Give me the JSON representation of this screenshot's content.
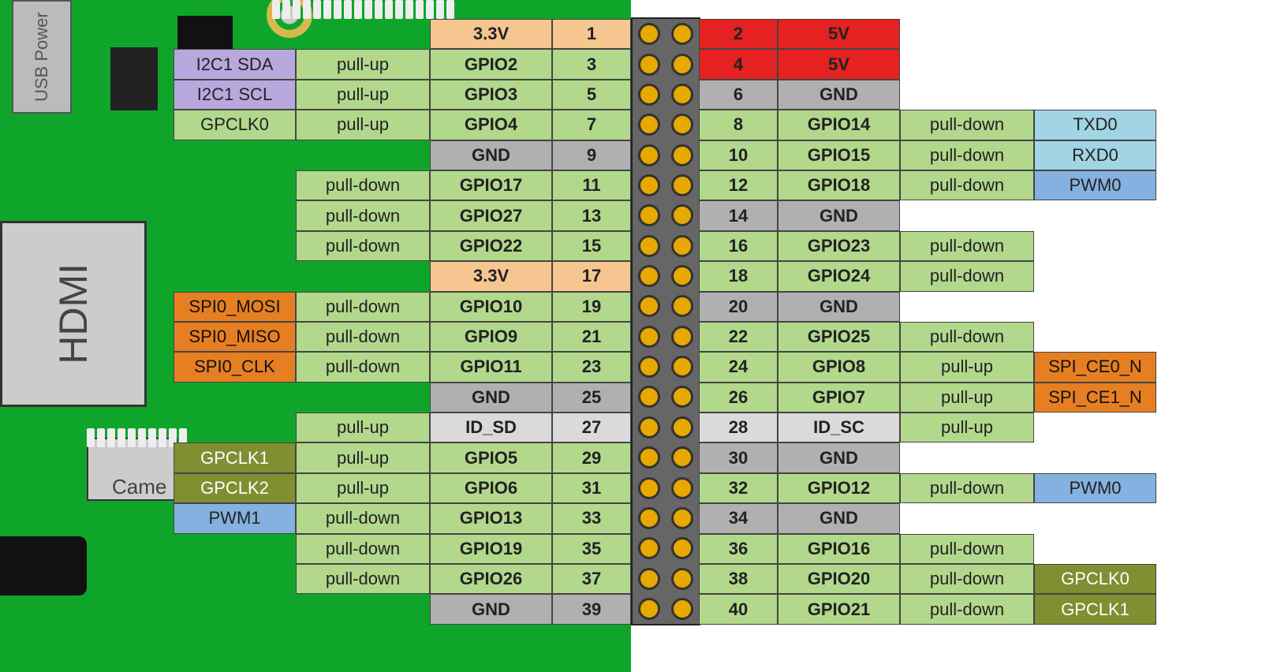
{
  "labels": {
    "usb": "USB\nPower",
    "hdmi": "HDMI",
    "camera": "Came"
  },
  "left": [
    {
      "num": "1",
      "name": "3.3V",
      "nc": "v33",
      "pull": "",
      "alt": "",
      "ac": ""
    },
    {
      "num": "3",
      "name": "GPIO2",
      "nc": "green",
      "pull": "pull-up",
      "alt": "I2C1 SDA",
      "ac": "alt-i2c"
    },
    {
      "num": "5",
      "name": "GPIO3",
      "nc": "green",
      "pull": "pull-up",
      "alt": "I2C1 SCL",
      "ac": "alt-i2c"
    },
    {
      "num": "7",
      "name": "GPIO4",
      "nc": "green",
      "pull": "pull-up",
      "alt": "GPCLK0",
      "ac": "alt-clk0"
    },
    {
      "num": "9",
      "name": "GND",
      "nc": "gnd",
      "pull": "",
      "alt": "",
      "ac": ""
    },
    {
      "num": "11",
      "name": "GPIO17",
      "nc": "green",
      "pull": "pull-down",
      "alt": "",
      "ac": ""
    },
    {
      "num": "13",
      "name": "GPIO27",
      "nc": "green",
      "pull": "pull-down",
      "alt": "",
      "ac": ""
    },
    {
      "num": "15",
      "name": "GPIO22",
      "nc": "green",
      "pull": "pull-down",
      "alt": "",
      "ac": ""
    },
    {
      "num": "17",
      "name": "3.3V",
      "nc": "v33",
      "pull": "",
      "alt": "",
      "ac": ""
    },
    {
      "num": "19",
      "name": "GPIO10",
      "nc": "green",
      "pull": "pull-down",
      "alt": "SPI0_MOSI",
      "ac": "alt-spi"
    },
    {
      "num": "21",
      "name": "GPIO9",
      "nc": "green",
      "pull": "pull-down",
      "alt": "SPI0_MISO",
      "ac": "alt-spi"
    },
    {
      "num": "23",
      "name": "GPIO11",
      "nc": "green",
      "pull": "pull-down",
      "alt": "SPI0_CLK",
      "ac": "alt-spi"
    },
    {
      "num": "25",
      "name": "GND",
      "nc": "gnd",
      "pull": "",
      "alt": "",
      "ac": ""
    },
    {
      "num": "27",
      "name": "ID_SD",
      "nc": "idsd",
      "pull": "pull-up",
      "alt": "",
      "ac": ""
    },
    {
      "num": "29",
      "name": "GPIO5",
      "nc": "green",
      "pull": "pull-up",
      "alt": "GPCLK1",
      "ac": "alt-clk"
    },
    {
      "num": "31",
      "name": "GPIO6",
      "nc": "green",
      "pull": "pull-up",
      "alt": "GPCLK2",
      "ac": "alt-clk"
    },
    {
      "num": "33",
      "name": "GPIO13",
      "nc": "green",
      "pull": "pull-down",
      "alt": "PWM1",
      "ac": "alt-pwm"
    },
    {
      "num": "35",
      "name": "GPIO19",
      "nc": "green",
      "pull": "pull-down",
      "alt": "",
      "ac": ""
    },
    {
      "num": "37",
      "name": "GPIO26",
      "nc": "green",
      "pull": "pull-down",
      "alt": "",
      "ac": ""
    },
    {
      "num": "39",
      "name": "GND",
      "nc": "gnd",
      "pull": "",
      "alt": "",
      "ac": ""
    }
  ],
  "right": [
    {
      "num": "2",
      "name": "5V",
      "nc": "v5",
      "pull": "",
      "alt": "",
      "ac": ""
    },
    {
      "num": "4",
      "name": "5V",
      "nc": "v5",
      "pull": "",
      "alt": "",
      "ac": ""
    },
    {
      "num": "6",
      "name": "GND",
      "nc": "gnd",
      "pull": "",
      "alt": "",
      "ac": ""
    },
    {
      "num": "8",
      "name": "GPIO14",
      "nc": "green",
      "pull": "pull-down",
      "alt": "TXD0",
      "ac": "alt-uart"
    },
    {
      "num": "10",
      "name": "GPIO15",
      "nc": "green",
      "pull": "pull-down",
      "alt": "RXD0",
      "ac": "alt-uart"
    },
    {
      "num": "12",
      "name": "GPIO18",
      "nc": "green",
      "pull": "pull-down",
      "alt": "PWM0",
      "ac": "alt-pwm"
    },
    {
      "num": "14",
      "name": "GND",
      "nc": "gnd",
      "pull": "",
      "alt": "",
      "ac": ""
    },
    {
      "num": "16",
      "name": "GPIO23",
      "nc": "green",
      "pull": "pull-down",
      "alt": "",
      "ac": ""
    },
    {
      "num": "18",
      "name": "GPIO24",
      "nc": "green",
      "pull": "pull-down",
      "alt": "",
      "ac": ""
    },
    {
      "num": "20",
      "name": "GND",
      "nc": "gnd",
      "pull": "",
      "alt": "",
      "ac": ""
    },
    {
      "num": "22",
      "name": "GPIO25",
      "nc": "green",
      "pull": "pull-down",
      "alt": "",
      "ac": ""
    },
    {
      "num": "24",
      "name": "GPIO8",
      "nc": "green",
      "pull": "pull-up",
      "alt": "SPI_CE0_N",
      "ac": "alt-spi"
    },
    {
      "num": "26",
      "name": "GPIO7",
      "nc": "green",
      "pull": "pull-up",
      "alt": "SPI_CE1_N",
      "ac": "alt-spi"
    },
    {
      "num": "28",
      "name": "ID_SC",
      "nc": "idsd",
      "pull": "pull-up",
      "alt": "",
      "ac": ""
    },
    {
      "num": "30",
      "name": "GND",
      "nc": "gnd",
      "pull": "",
      "alt": "",
      "ac": ""
    },
    {
      "num": "32",
      "name": "GPIO12",
      "nc": "green",
      "pull": "pull-down",
      "alt": "PWM0",
      "ac": "alt-pwm"
    },
    {
      "num": "34",
      "name": "GND",
      "nc": "gnd",
      "pull": "",
      "alt": "",
      "ac": ""
    },
    {
      "num": "36",
      "name": "GPIO16",
      "nc": "green",
      "pull": "pull-down",
      "alt": "",
      "ac": ""
    },
    {
      "num": "38",
      "name": "GPIO20",
      "nc": "green",
      "pull": "pull-down",
      "alt": "GPCLK0",
      "ac": "alt-clk"
    },
    {
      "num": "40",
      "name": "GPIO21",
      "nc": "green",
      "pull": "pull-down",
      "alt": "GPCLK1",
      "ac": "alt-clk"
    }
  ]
}
